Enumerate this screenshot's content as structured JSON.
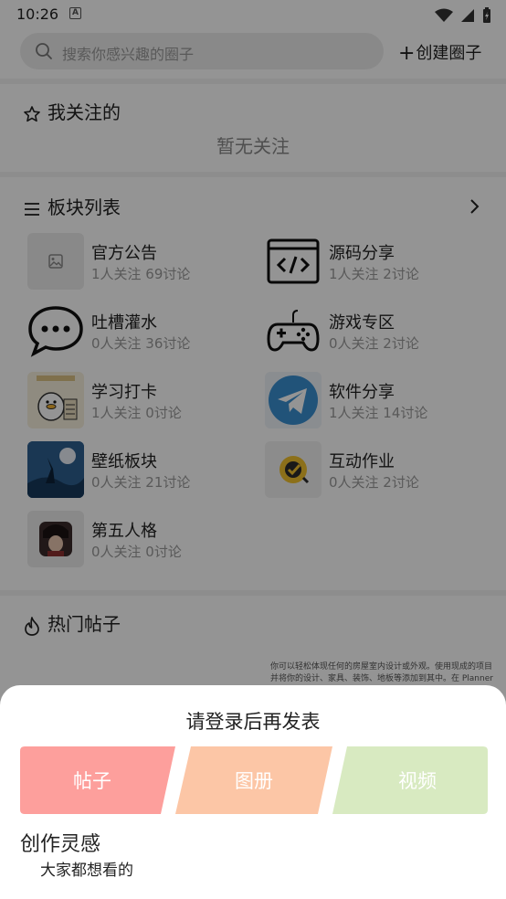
{
  "status_bar": {
    "time": "10:26"
  },
  "search": {
    "placeholder": "搜索你感兴趣的圈子"
  },
  "create_button": {
    "label": "创建圈子"
  },
  "following": {
    "title": "我关注的",
    "empty_text": "暂无关注"
  },
  "boards": {
    "title": "板块列表",
    "items": [
      {
        "name": "官方公告",
        "stats": "1人关注 69讨论",
        "icon": "image-placeholder-icon"
      },
      {
        "name": "源码分享",
        "stats": "1人关注 2讨论",
        "icon": "code-window-icon"
      },
      {
        "name": "吐槽灌水",
        "stats": "0人关注 36讨论",
        "icon": "chat-bubble-icon"
      },
      {
        "name": "游戏专区",
        "stats": "0人关注 2讨论",
        "icon": "gamepad-icon"
      },
      {
        "name": "学习打卡",
        "stats": "1人关注 0讨论",
        "icon": "study-duck-icon"
      },
      {
        "name": "软件分享",
        "stats": "1人关注 14讨论",
        "icon": "telegram-plane-icon"
      },
      {
        "name": "壁纸板块",
        "stats": "0人关注 21讨论",
        "icon": "wallpaper-icon"
      },
      {
        "name": "互动作业",
        "stats": "0人关注 2讨论",
        "icon": "check-badge-icon"
      },
      {
        "name": "第五人格",
        "stats": "0人关注 0讨论",
        "icon": "game-avatar-icon"
      }
    ]
  },
  "hot_posts": {
    "title": "热门帖子",
    "promo_text": "你可以轻松体现任何的房屋室内设计或外观。使用现成的项目并将你的设计、家具、装饰、地板等添加到其中。在 Planner"
  },
  "sheet": {
    "title": "请登录后再发表",
    "buttons": [
      {
        "label": "帖子",
        "color": "#fd9f9c"
      },
      {
        "label": "图册",
        "color": "#fcc6a6"
      },
      {
        "label": "视频",
        "color": "#d8eac1"
      }
    ],
    "inspiration_title": "创作灵感",
    "inspiration_subtitle": "大家都想看的"
  }
}
